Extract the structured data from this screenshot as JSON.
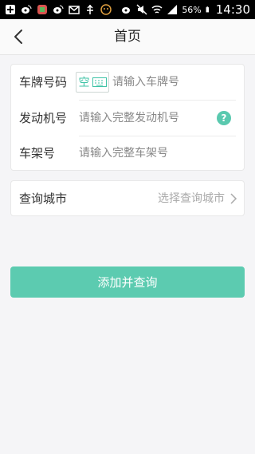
{
  "status_bar": {
    "battery": "56%",
    "time": "14:30",
    "icons_left": [
      "add-icon",
      "weibo-icon",
      "app-icon",
      "weibo-icon",
      "mail-icon",
      "usb-icon",
      "emoji-icon"
    ],
    "icons_right": [
      "weibo-icon",
      "mute-icon",
      "wifi-icon",
      "signal-icon",
      "battery-icon"
    ]
  },
  "nav": {
    "title": "首页",
    "back_icon": "chevron-left-icon"
  },
  "form": {
    "plate": {
      "label": "车牌号码",
      "toggle_left": "空",
      "toggle_icon": "keyboard-icon",
      "placeholder": "请输入车牌号"
    },
    "engine": {
      "label": "发动机号",
      "placeholder": "请输入完整发动机号",
      "help": "?"
    },
    "vin": {
      "label": "车架号",
      "placeholder": "请输入完整车架号"
    }
  },
  "city": {
    "label": "查询城市",
    "placeholder": "选择查询城市",
    "chevron_icon": "chevron-right-icon"
  },
  "submit_label": "添加并查询",
  "colors": {
    "accent": "#5ccbb0",
    "toggle": "#3ec3a6"
  }
}
